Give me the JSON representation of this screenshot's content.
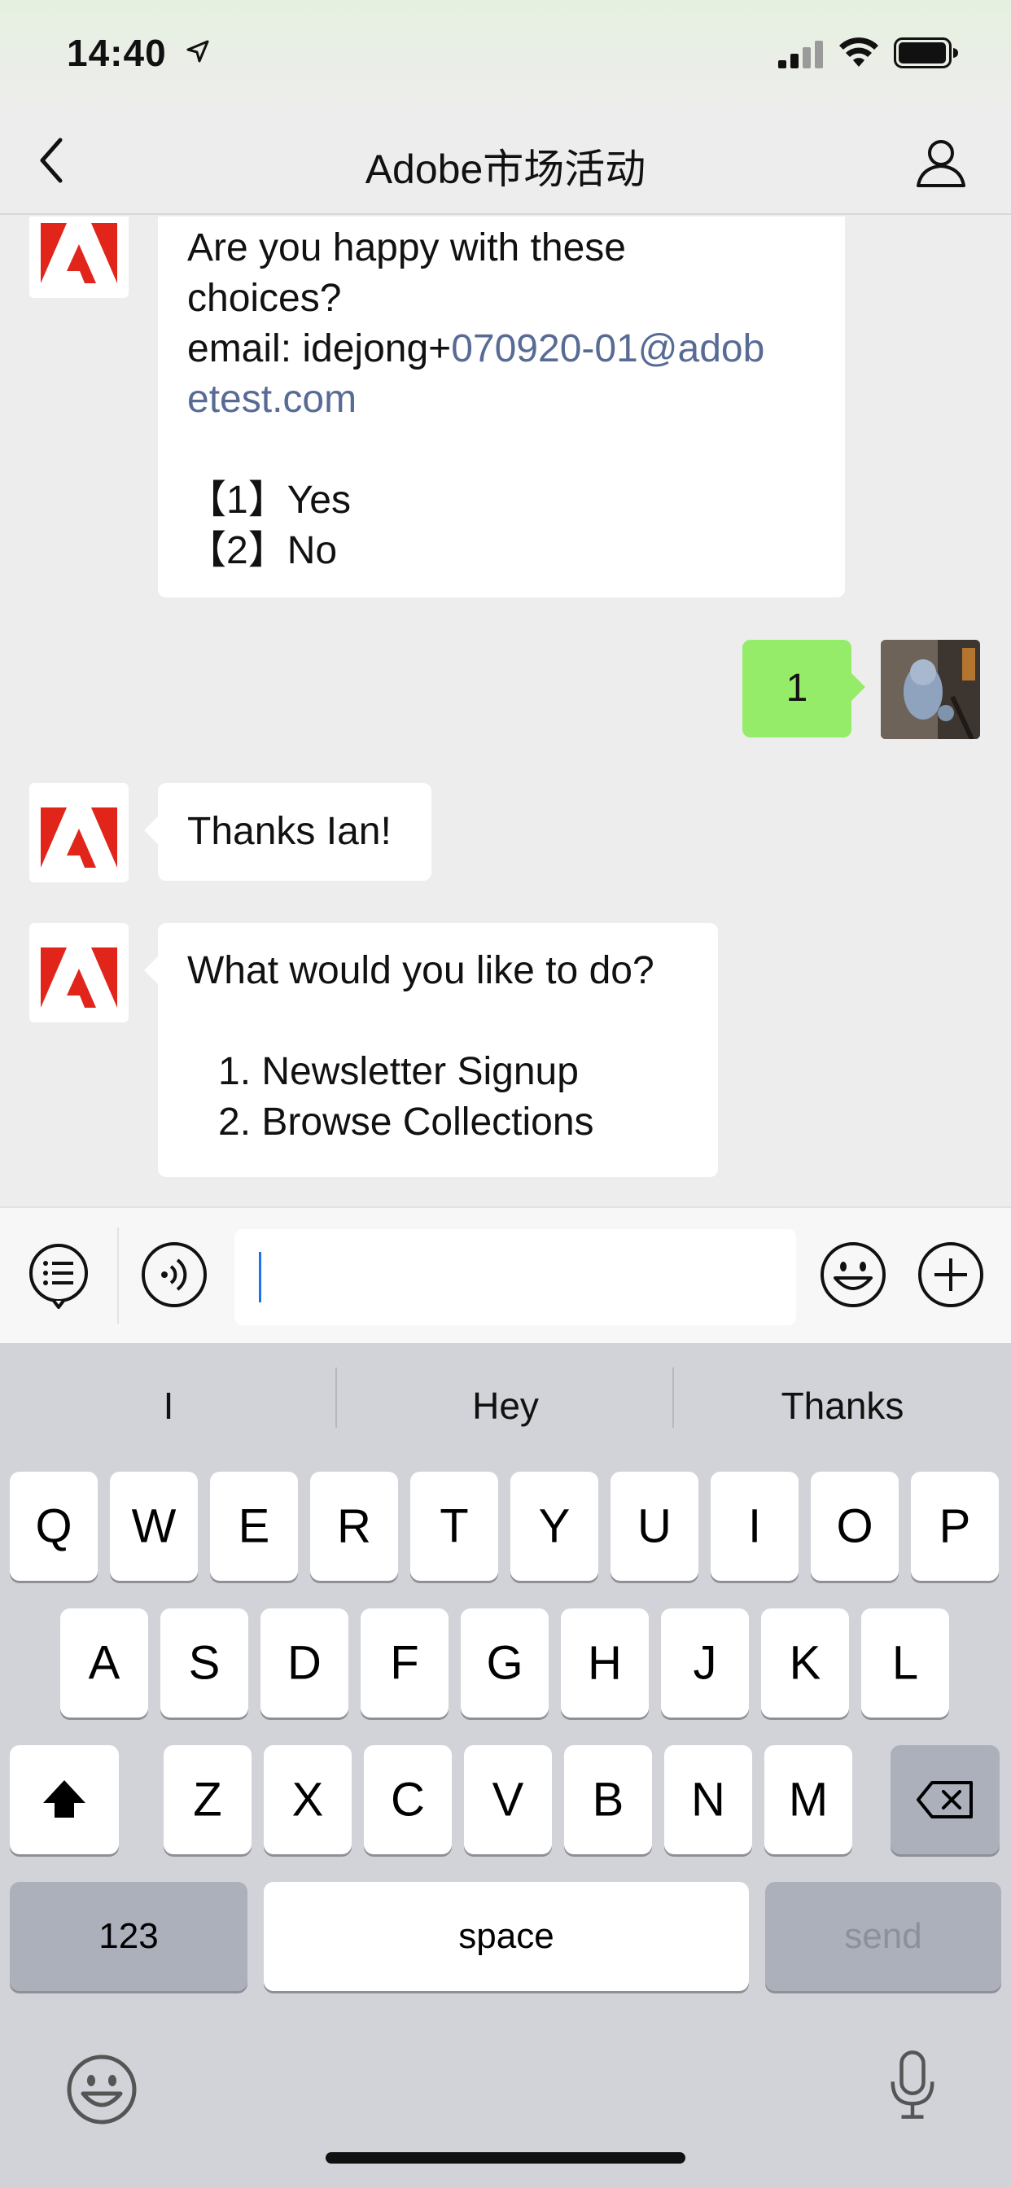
{
  "status_bar": {
    "time": "14:40"
  },
  "nav": {
    "title": "Adobe市场活动"
  },
  "messages": [
    {
      "from": "bot",
      "lines": [
        "Are you happy with these",
        "choices?"
      ],
      "email_prefix": "email: idejong+",
      "email_link_1": "070920-01@adob",
      "email_link_2": "etest.com",
      "options": [
        "【1】Yes",
        "【2】No"
      ]
    },
    {
      "from": "me",
      "text": "1"
    },
    {
      "from": "bot",
      "text": "Thanks Ian!"
    },
    {
      "from": "bot",
      "lines": [
        "What would you like to do?"
      ],
      "options": [
        "1. Newsletter Signup",
        "2. Browse Collections"
      ]
    }
  ],
  "input": {
    "value": ""
  },
  "suggestions": [
    "I",
    "Hey",
    "Thanks"
  ],
  "keyboard": {
    "row1": [
      "Q",
      "W",
      "E",
      "R",
      "T",
      "Y",
      "U",
      "I",
      "O",
      "P"
    ],
    "row2": [
      "A",
      "S",
      "D",
      "F",
      "G",
      "H",
      "J",
      "K",
      "L"
    ],
    "row3": [
      "Z",
      "X",
      "C",
      "V",
      "B",
      "N",
      "M"
    ],
    "numbers_label": "123",
    "space_label": "space",
    "send_label": "send"
  },
  "colors": {
    "adobe_red": "#e1251b",
    "bubble_green": "#95ec69",
    "link": "#576b95"
  }
}
